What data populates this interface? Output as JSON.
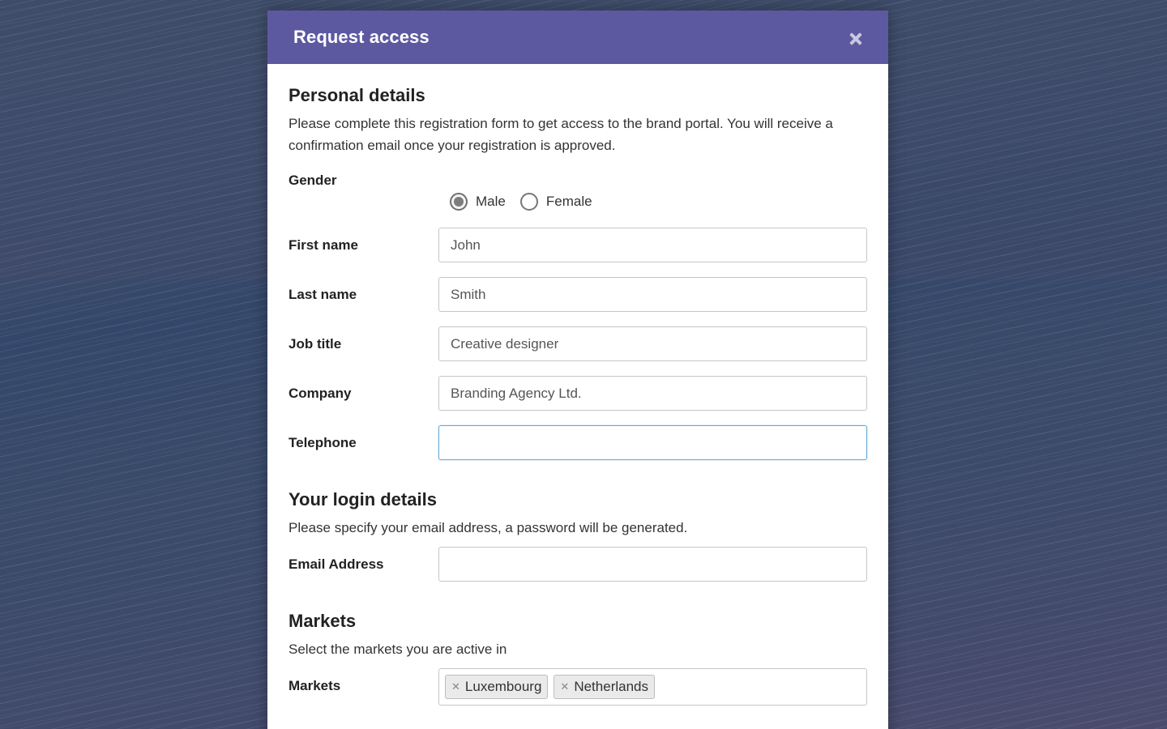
{
  "modal": {
    "title": "Request access",
    "close_icon": "close-icon"
  },
  "personal": {
    "title": "Personal details",
    "description": "Please complete this registration form to get access to the brand portal. You will receive a confirmation email once your registration is approved.",
    "gender": {
      "label": "Gender",
      "options": [
        "Male",
        "Female"
      ],
      "selected": "Male"
    },
    "first_name": {
      "label": "First name",
      "value": "John"
    },
    "last_name": {
      "label": "Last name",
      "value": "Smith"
    },
    "job_title": {
      "label": "Job title",
      "value": "Creative designer"
    },
    "company": {
      "label": "Company",
      "value": "Branding Agency Ltd."
    },
    "telephone": {
      "label": "Telephone",
      "value": ""
    }
  },
  "login": {
    "title": "Your login details",
    "description": "Please specify your email address, a password will be generated.",
    "email": {
      "label": "Email Address",
      "value": ""
    }
  },
  "markets": {
    "title": "Markets",
    "description": "Select the markets you are active in",
    "label": "Markets",
    "selected": [
      "Luxembourg",
      "Netherlands"
    ]
  },
  "colors": {
    "header": "#5c59a1",
    "focus_border": "#67a9d6"
  }
}
